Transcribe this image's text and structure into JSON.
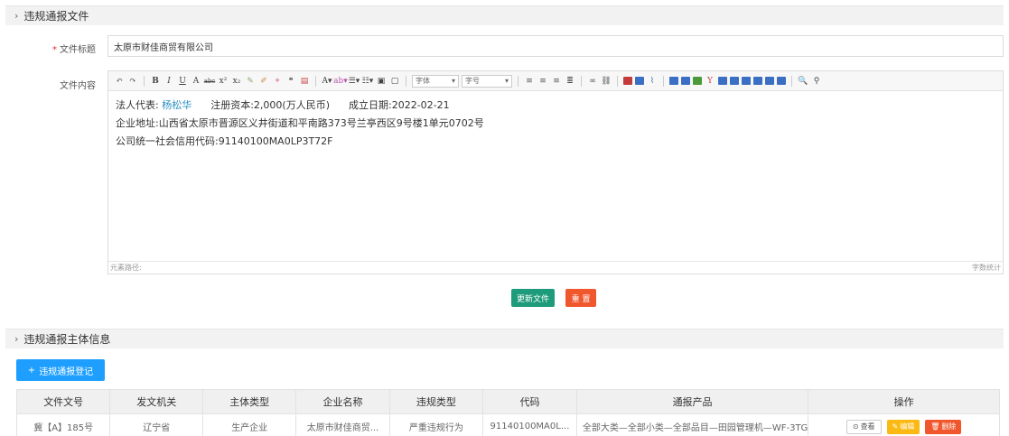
{
  "section1": {
    "title": "违规通报文件"
  },
  "form": {
    "title_label": "文件标题",
    "title_value": "太原市财佳商贸有限公司",
    "content_label": "文件内容"
  },
  "editor": {
    "font_placeholder": "字体",
    "size_placeholder": "字号",
    "lines": {
      "rep_label": "法人代表:",
      "rep_name": "杨松华",
      "capital": "注册资本:2,000(万人民币)",
      "date": "成立日期:2022-02-21",
      "address": "企业地址:山西省太原市晋源区义井街道和平南路373号兰亭西区9号楼1单元0702号",
      "credit": "公司统一社会信用代码:91140100MA0LP3T72F"
    },
    "status_left": "元素路径:",
    "status_right": "字数统计"
  },
  "buttons": {
    "update": "更新文件",
    "reset": "重 置"
  },
  "section2": {
    "title": "违规通报主体信息"
  },
  "add_button": "违规通报登记",
  "table": {
    "headers": [
      "文件文号",
      "发文机关",
      "主体类型",
      "企业名称",
      "违规类型",
      "代码",
      "通报产品",
      "操作"
    ],
    "rows": [
      {
        "doc_no": "冀【A】185号",
        "authority": "辽宁省",
        "subject_type": "生产企业",
        "company": "太原市财佳商贸...",
        "violation": "严重违规行为",
        "code": "91140100MA0L...",
        "product": "全部大类—全部小类—全部品目—田园管理机—WF-3TG",
        "view": "查看",
        "edit": "编辑",
        "delete": "删除"
      }
    ]
  },
  "colors": {
    "primary": "#1e9fff",
    "green": "#1e9b7a",
    "orange": "#f0572c",
    "yellow": "#fbb913",
    "link": "#2b8fc4"
  }
}
